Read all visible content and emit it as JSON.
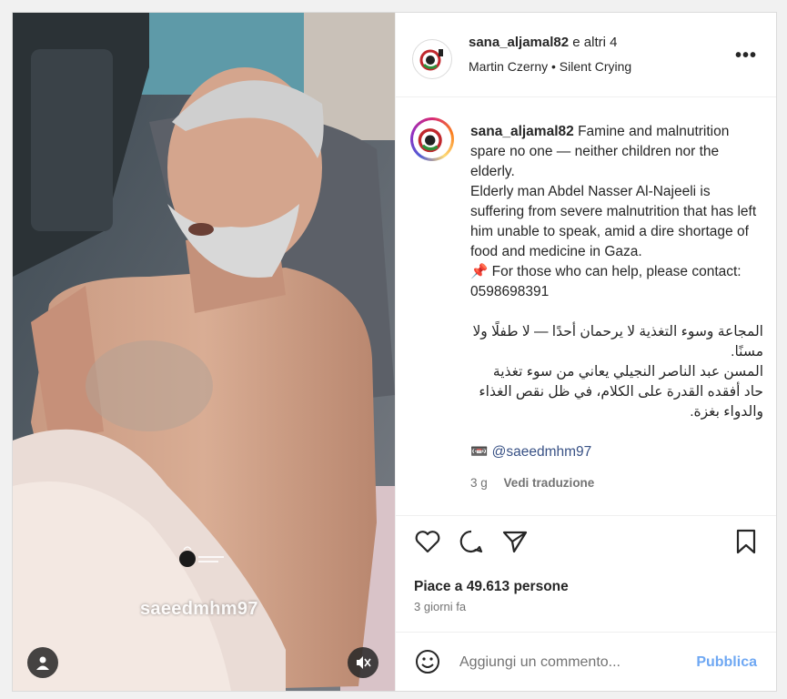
{
  "post": {
    "watermark": "saeedmhm97",
    "header": {
      "author": "sana_aljamal82",
      "coauthors": " e altri 4",
      "subtitle": "Martin Czerny • Silent Crying"
    },
    "caption": {
      "username": "sana_aljamal82",
      "en_intro": " Famine and malnutrition spare no one — neither children nor the elderly.",
      "en_body": "Elderly man Abdel Nasser Al-Najeeli is suffering from severe malnutrition that has left him unable to speak, amid a dire shortage of food and medicine in Gaza.",
      "en_help": "📌 For those who can help, please contact: 0598698391",
      "ar_intro": "المجاعة وسوء التغذية لا يرحمان أحدًا — لا طفلًا ولا مسنًا.",
      "ar_body": "المسن عبد الناصر النجيلي يعاني من سوء تغذية حاد أفقده القدرة على الكلام، في ظل نقص الغذاء والدواء بغزة.",
      "mention_icon": "📼",
      "mention": "@saeedmhm97"
    },
    "meta": {
      "age": "3 g",
      "translate": "Vedi traduzione"
    },
    "likes": "Piace a 49.613 persone",
    "date": "3 giorni fa",
    "comment_placeholder": "Aggiungi un commento...",
    "publish": "Pubblica",
    "icons": {
      "like": "heart-icon",
      "comment": "comment-icon",
      "share": "send-icon",
      "save": "bookmark-icon",
      "more": "more-icon",
      "emoji": "emoji-icon",
      "user": "user-tag-icon",
      "mute": "muted-speaker-icon"
    }
  }
}
